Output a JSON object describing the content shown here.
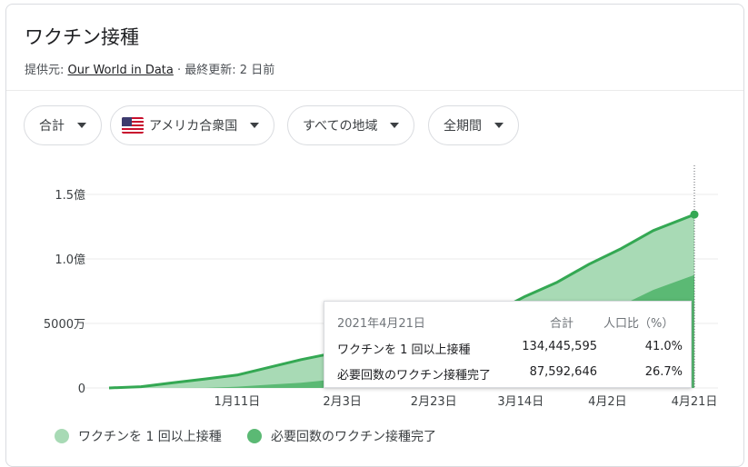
{
  "header": {
    "title": "ワクチン接種",
    "source_prefix": "提供元: ",
    "source_link": "Our World in Data",
    "source_suffix": " · 最終更新: 2 日前"
  },
  "filters": {
    "metric": "合計",
    "country": "アメリカ合衆国",
    "region": "すべての地域",
    "period": "全期間"
  },
  "colors": {
    "at_least_one_dose": "#a8dab5",
    "fully_vaccinated": "#5bb974",
    "line": "#34a853",
    "grid": "#ebebeb"
  },
  "tooltip": {
    "date": "2021年4月21日",
    "col_total": "合計",
    "col_pct": "人口比（%）",
    "rows": [
      {
        "label": "ワクチンを 1 回以上接種",
        "total": "134,445,595",
        "pct": "41.0%"
      },
      {
        "label": "必要回数のワクチン接種完了",
        "total": "87,592,646",
        "pct": "26.7%"
      }
    ]
  },
  "legend": [
    {
      "label": "ワクチンを 1 回以上接種",
      "color": "#a8dab5"
    },
    {
      "label": "必要回数のワクチン接種完了",
      "color": "#5bb974"
    }
  ],
  "chart_data": {
    "type": "area",
    "x": [
      "2020-12-14",
      "2020-12-21",
      "2020-12-28",
      "2021-01-04",
      "2021-01-11",
      "2021-01-18",
      "2021-01-25",
      "2021-02-01",
      "2021-02-08",
      "2021-02-15",
      "2021-02-22",
      "2021-03-01",
      "2021-03-08",
      "2021-03-15",
      "2021-03-22",
      "2021-03-29",
      "2021-04-05",
      "2021-04-12",
      "2021-04-21"
    ],
    "series": [
      {
        "name": "ワクチンを 1 回以上接種",
        "values": [
          0,
          1000000,
          4000000,
          7000000,
          10000000,
          16000000,
          22000000,
          27000000,
          32000000,
          37000000,
          42000000,
          50000000,
          58000000,
          71000000,
          82000000,
          96000000,
          108000000,
          122000000,
          134445595
        ]
      },
      {
        "name": "必要回数のワクチン接種完了",
        "values": [
          0,
          0,
          0,
          100000,
          1000000,
          2500000,
          4000000,
          6500000,
          10000000,
          14000000,
          19000000,
          24000000,
          30000000,
          37000000,
          45000000,
          54000000,
          64000000,
          76000000,
          87592646
        ]
      }
    ],
    "y_ticks": [
      "0",
      "5000万",
      "1.0億",
      "1.5億"
    ],
    "y_tick_values": [
      0,
      50000000,
      100000000,
      150000000
    ],
    "x_tick_labels": [
      "1月11日",
      "2月3日",
      "2月23日",
      "3月14日",
      "4月2日",
      "4月21日"
    ],
    "x_tick_dates": [
      "2021-01-11",
      "2021-02-03",
      "2021-02-23",
      "2021-03-14",
      "2021-04-02",
      "2021-04-21"
    ],
    "ylim": [
      0,
      150000000
    ],
    "grid": true,
    "legend_position": "bottom"
  }
}
